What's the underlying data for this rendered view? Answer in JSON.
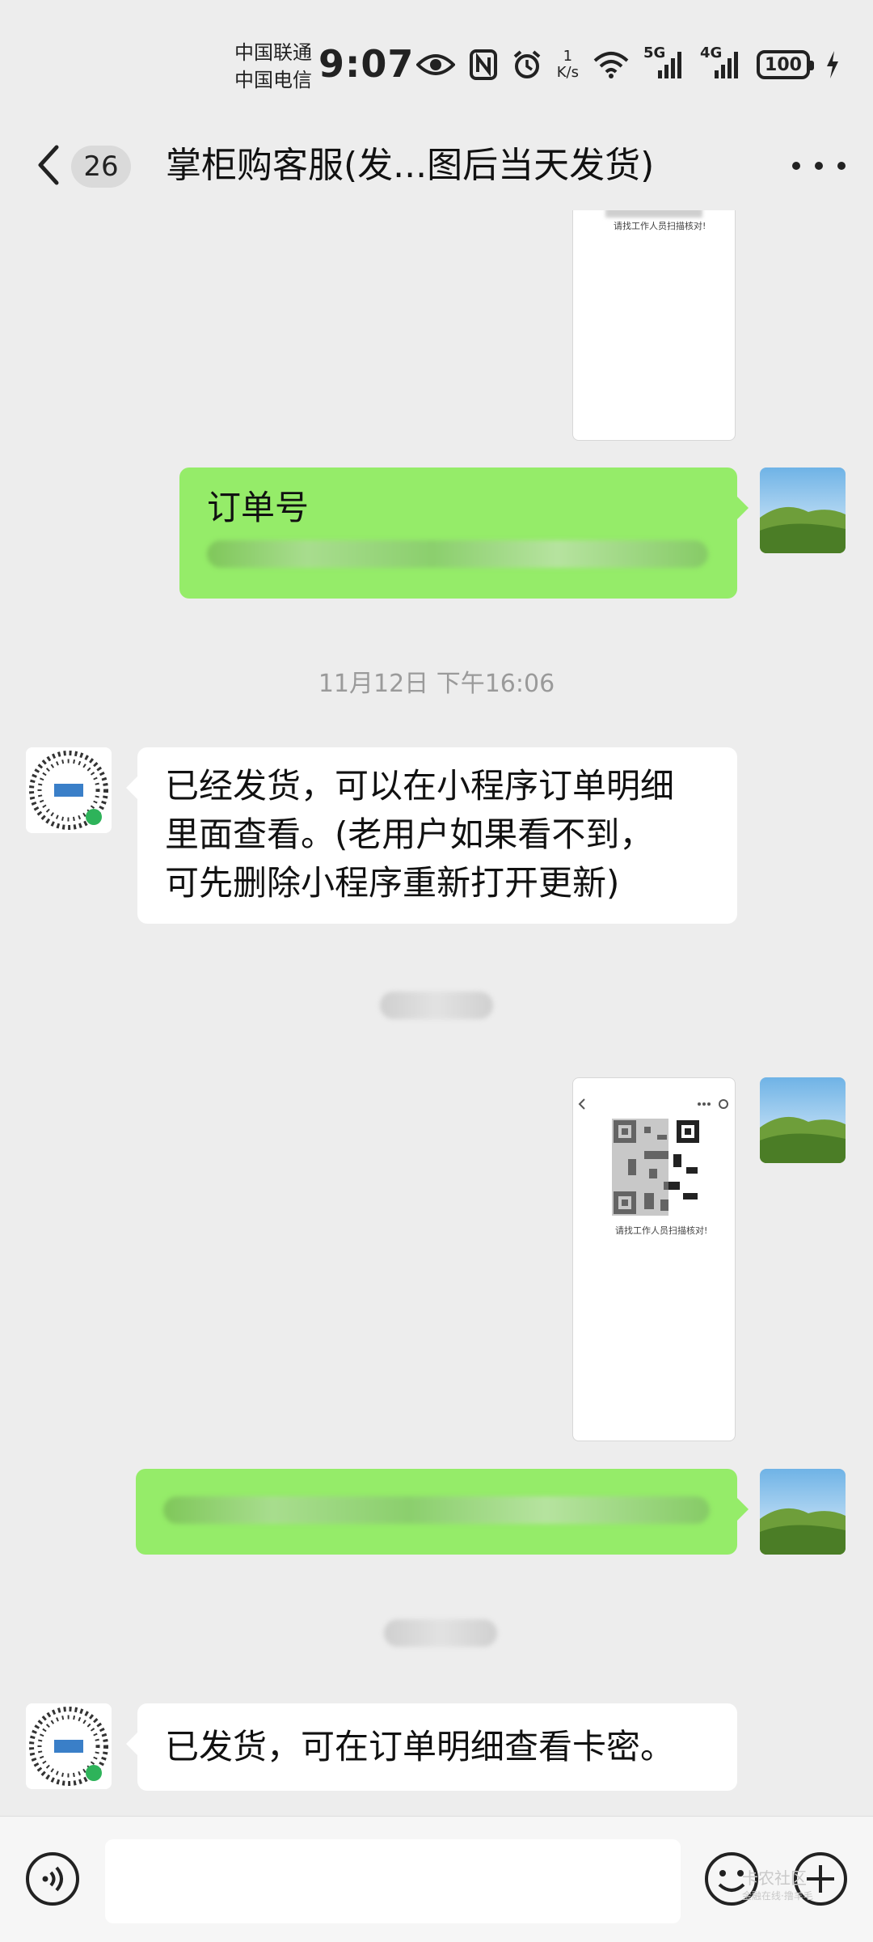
{
  "status_bar": {
    "carrier_1": "中国联通",
    "carrier_2": "中国电信",
    "time": "9:07",
    "net_speed_value": "1",
    "net_speed_unit": "K/s",
    "signal_1_label": "5G",
    "signal_2_label": "4G",
    "battery": "100",
    "icons": [
      "eye-icon",
      "nfc-icon",
      "alarm-icon",
      "wifi-icon",
      "signal-5g-icon",
      "signal-4g-icon",
      "battery-icon",
      "charging-icon"
    ]
  },
  "nav": {
    "back_icon": "chevron-left-icon",
    "unread_count": "26",
    "title": "掌柜购客服(发...图后当天发货)",
    "more_icon": "more-dots-icon"
  },
  "messages": [
    {
      "type": "image",
      "side": "right",
      "caption": "请找工作人员扫描核对!"
    },
    {
      "type": "text",
      "side": "right",
      "text": "订单号"
    },
    {
      "type": "timestamp",
      "text": "11月12日 下午16:06"
    },
    {
      "type": "text",
      "side": "left",
      "lines": [
        "已经发货，可以在小程序订单明细",
        "里面查看。(老用户如果看不到，",
        "可先删除小程序重新打开更新)"
      ]
    },
    {
      "type": "timestamp",
      "text": ""
    },
    {
      "type": "image",
      "side": "right",
      "caption": "请找工作人员扫描核对!"
    },
    {
      "type": "text",
      "side": "right",
      "text": ""
    },
    {
      "type": "timestamp",
      "text": ""
    },
    {
      "type": "text",
      "side": "left",
      "text": "已发货，可在订单明细查看卡密。"
    }
  ],
  "input_bar": {
    "voice_icon": "voice-icon",
    "input_value": "",
    "emoji_icon": "emoji-icon",
    "plus_icon": "plus-icon"
  },
  "watermark": {
    "line_1": "卡农社区",
    "line_2": "金融在线·撸羊毛"
  },
  "colors": {
    "background": "#ededed",
    "sent_bubble": "#95ec69",
    "received_bubble": "#ffffff",
    "timestamp_text": "#9a9a9a"
  }
}
